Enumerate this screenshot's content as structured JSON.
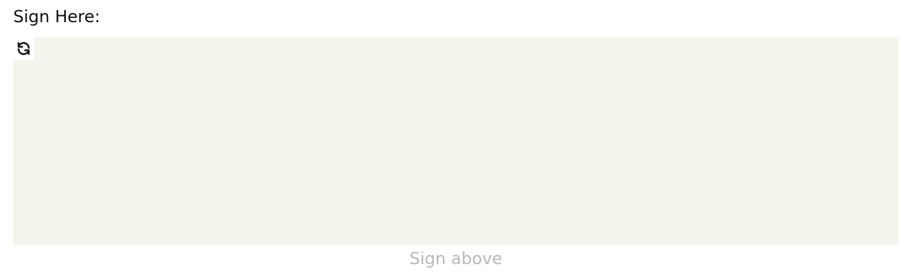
{
  "title": "Sign Here:",
  "signature_pad": {
    "background": "#f5f4ec",
    "reset_icon": "refresh-icon"
  },
  "hint": "Sign above",
  "colors": {
    "title_text": "#111111",
    "hint_text": "#b9b9b9"
  }
}
